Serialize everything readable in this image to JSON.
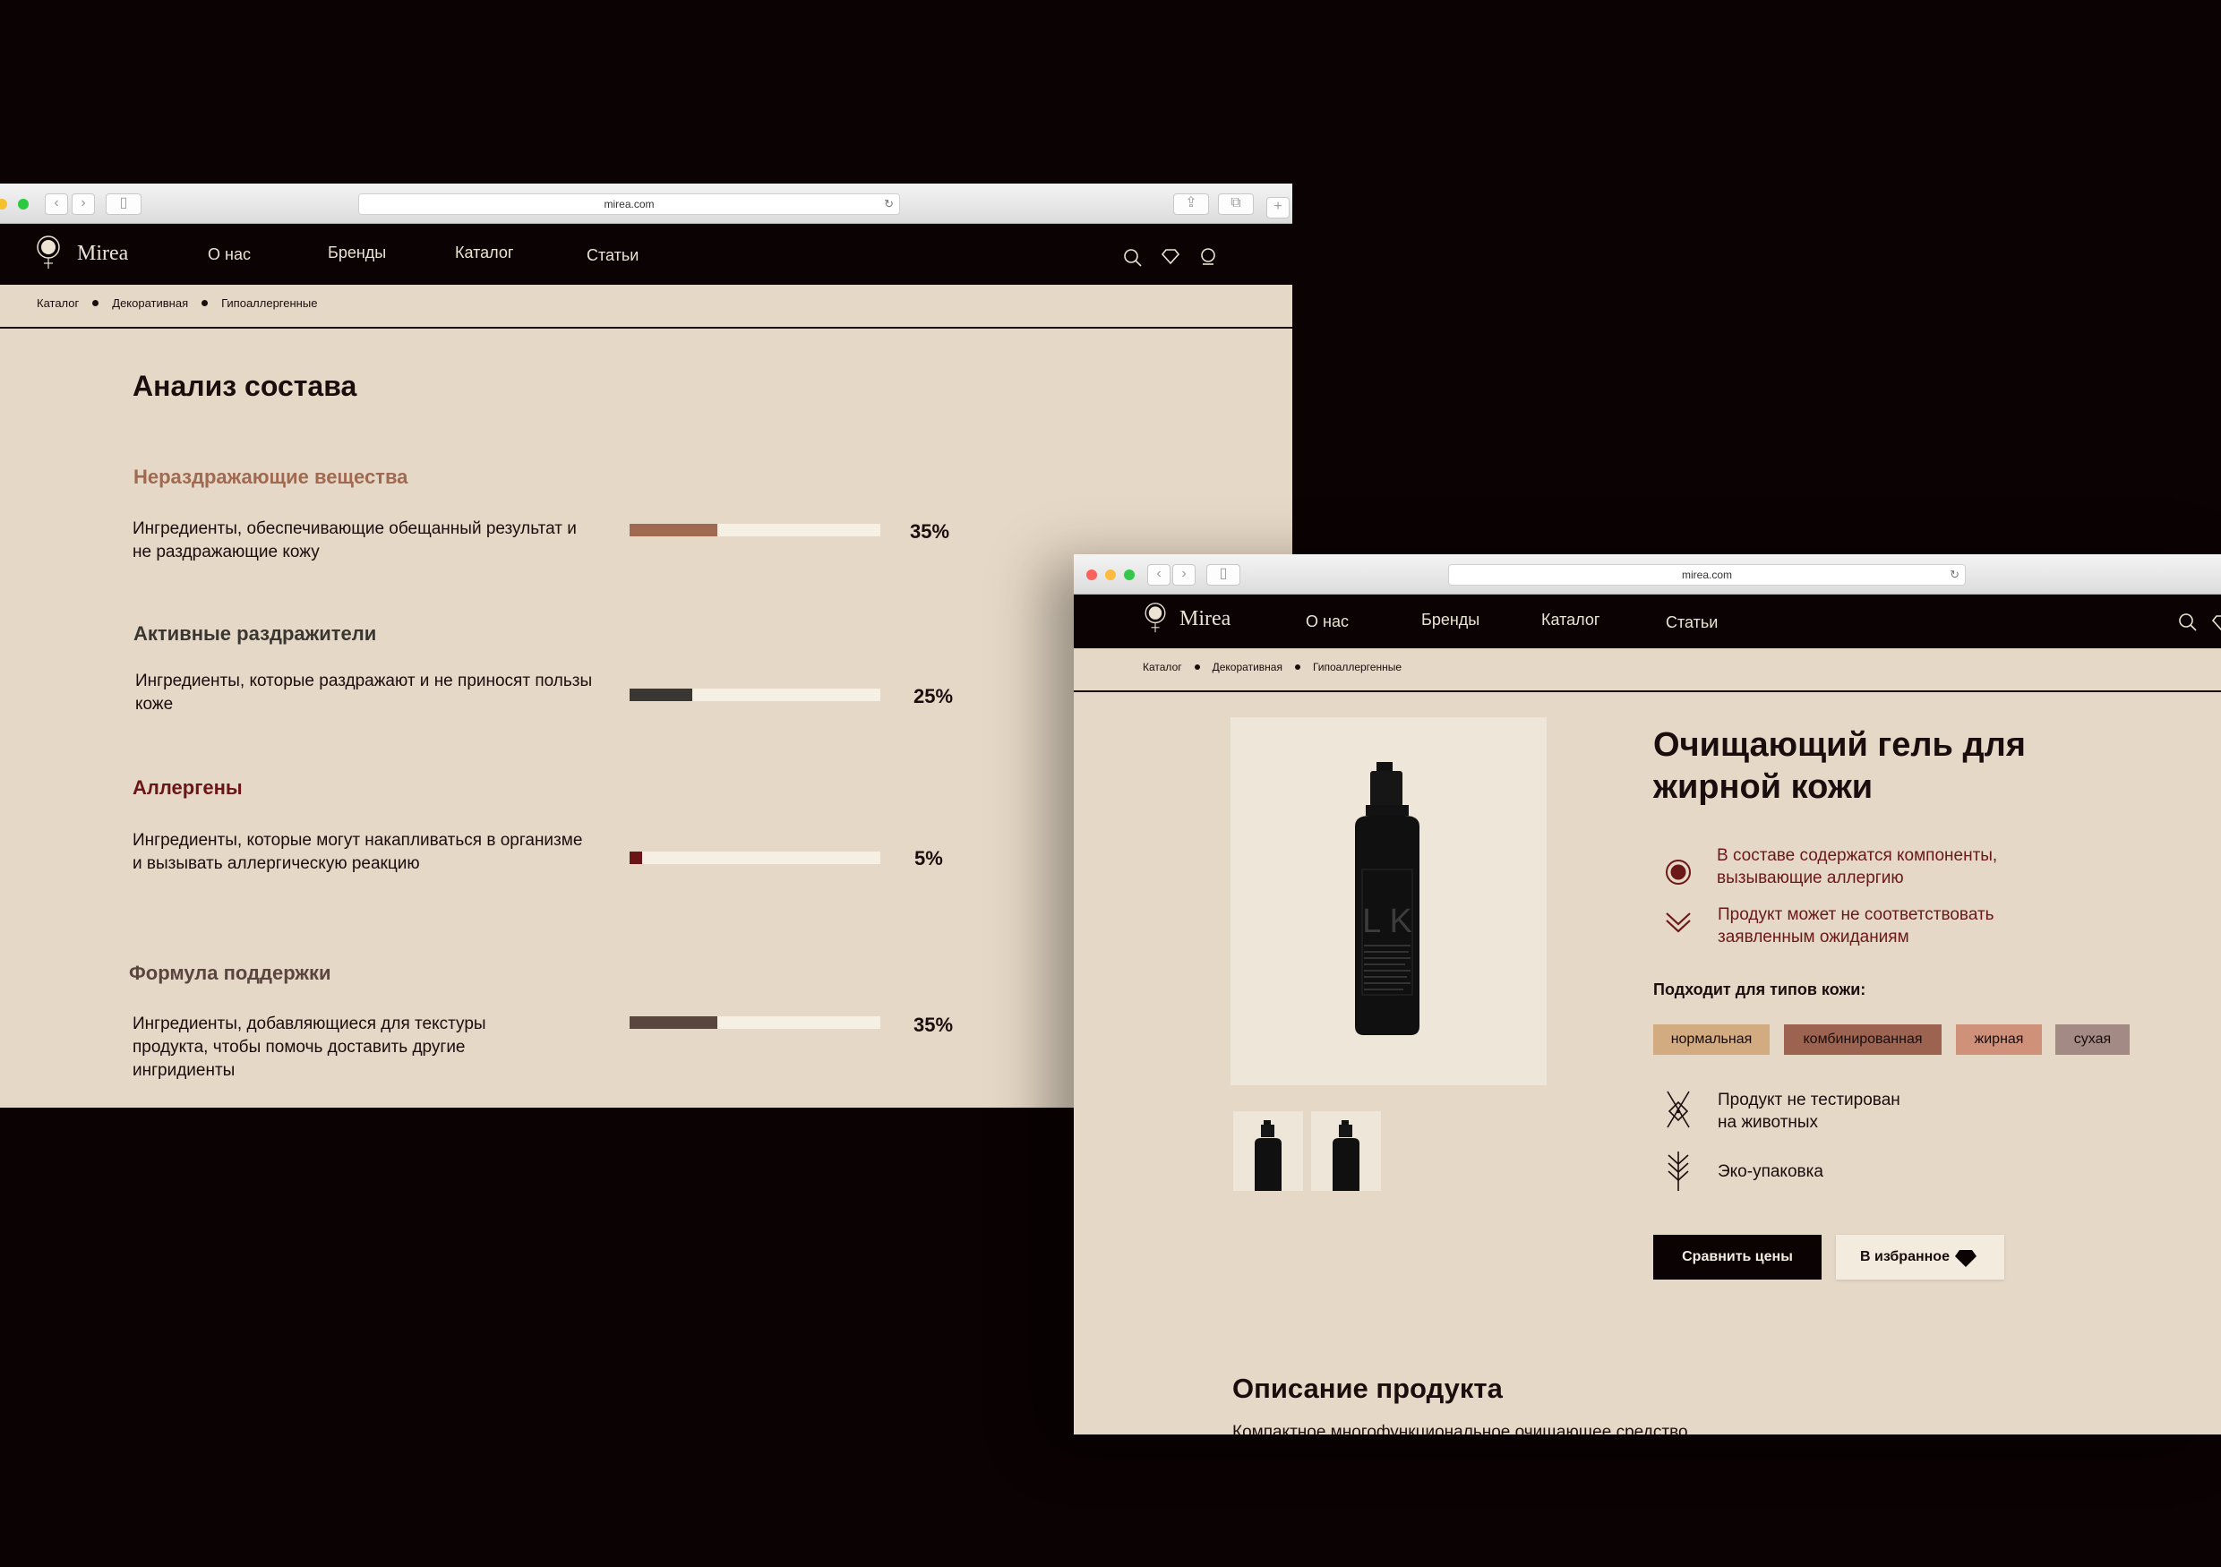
{
  "browser_url": "mirea.com",
  "brand": "Mirea",
  "nav": [
    "О нас",
    "Бренды",
    "Каталог",
    "Статьи"
  ],
  "breadcrumb": [
    "Каталог",
    "Декоративная",
    "Гипоаллергенные"
  ],
  "analysis": {
    "title": "Анализ состава",
    "sections": [
      {
        "title": "Нераздражающие вещества",
        "title_color": "#a06a52",
        "desc": "Ингредиенты, обеспечивающие обещанный результат и не раздражающие кожу",
        "percent_label": "35%",
        "value": 35,
        "bar_color": "#a06a52"
      },
      {
        "title": "Активные раздражители",
        "title_color": "#3a3632",
        "desc": "Ингредиенты, которые раздражают и не приносят пользы коже",
        "percent_label": "25%",
        "value": 25,
        "bar_color": "#3a3632"
      },
      {
        "title": "Аллергены",
        "title_color": "#6a1616",
        "desc": "Ингредиенты, которые могут накапливаться в организме и вызывать аллергическую реакцию",
        "percent_label": "5%",
        "value": 5,
        "bar_color": "#6a1616"
      },
      {
        "title": "Формула поддержки",
        "title_color": "#5a4640",
        "desc": "Ингредиенты, добавляющиеся для текстуры продукта, чтобы помочь доставить другие ингридиенты",
        "percent_label": "35%",
        "value": 35,
        "bar_color": "#5a4640"
      }
    ]
  },
  "product": {
    "title_line1": "Очищающий гель для",
    "title_line2": "жирной кожи",
    "warning1": "В составе содержатся компоненты, вызывающие аллергию",
    "warning2": "Продукт может не соответствовать заявленным ожиданиям",
    "skin_types_label": "Подходит для типов кожи:",
    "skin_types": [
      {
        "label": "нормальная",
        "color": "#d2ab80"
      },
      {
        "label": "комбинированная",
        "color": "#9c6450"
      },
      {
        "label": "жирная",
        "color": "#d0917a"
      },
      {
        "label": "сухая",
        "color": "#a48a84"
      }
    ],
    "feature1": "Продукт не тестирован на животных",
    "feature2": "Эко-упаковка",
    "compare_button": "Сравнить цены",
    "favorite_button": "В избранное",
    "description_title": "Описание продукта",
    "description_partial": "Компактное многофункциональное очищающее средство"
  },
  "bottle_label": "L K"
}
